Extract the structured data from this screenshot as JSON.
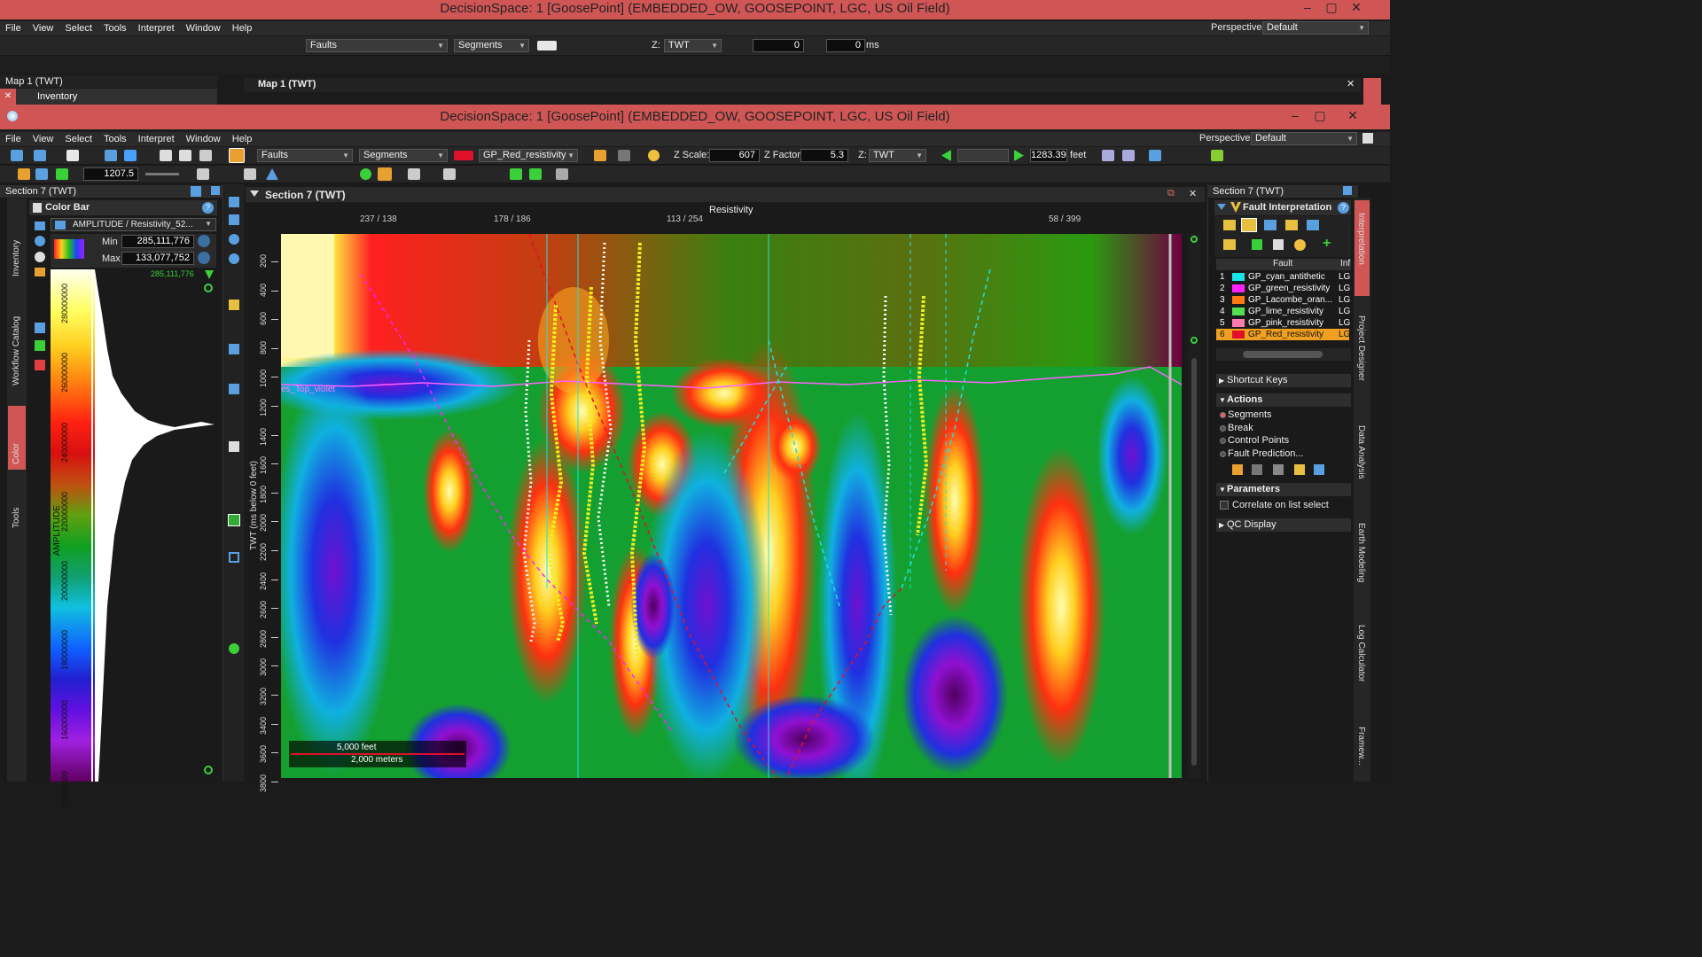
{
  "back_window": {
    "title": "DecisionSpace: 1 [GoosePoint] (EMBEDDED_OW, GOOSEPOINT, LGC, US Oil Field)",
    "menu": [
      "File",
      "View",
      "Select",
      "Tools",
      "Interpret",
      "Window",
      "Help"
    ],
    "perspective_label": "Perspective:",
    "perspective_value": "Default",
    "toolbar": {
      "faults_combo": "Faults",
      "segments_combo": "Segments",
      "z_combo": "TWT",
      "z_prefix": "Z:",
      "val1": "0",
      "val2": "0",
      "unit": "ms"
    },
    "map_panel_title": "Map 1 (TWT)",
    "inventory_tab": "Inventory",
    "map_view_title": "Map 1 (TWT)"
  },
  "window": {
    "title": "DecisionSpace: 1 [GoosePoint] (EMBEDDED_OW, GOOSEPOINT, LGC, US Oil Field)",
    "menu": [
      "File",
      "View",
      "Select",
      "Tools",
      "Interpret",
      "Window",
      "Help"
    ],
    "perspective_label": "Perspective:",
    "perspective_value": "Default"
  },
  "toolbar": {
    "faults_combo": "Faults",
    "segments_combo": "Segments",
    "property_combo": "GP_Red_resistivity",
    "zscale_label": "Z Scale:",
    "zscale_value": "607",
    "zfactor_label": "Z Factor:",
    "zfactor_value": "5.3",
    "z_label": "Z:",
    "z_combo": "TWT",
    "depth_value": "1283.39",
    "depth_unit": "feet",
    "secondary_value": "1207.5",
    "property_color": "#e0102a"
  },
  "left_panel": {
    "title": "Section 7 (TWT)",
    "colorbar_title": "Color Bar",
    "attribute": "AMPLITUDE / Resistivity_52...",
    "min_label": "Min",
    "min_value": "285,111,776",
    "max_label": "Max",
    "max_value": "133,077,752",
    "top_marker": "285,111,776",
    "axis_label": "AMPLITUDE",
    "ticks": [
      "280000000",
      "260000000",
      "240000000",
      "220000000",
      "200000000",
      "180000000",
      "160000000",
      "00000000"
    ],
    "vtabs": [
      "Inventory",
      "Workflow Catalog",
      "Color",
      "Tools"
    ]
  },
  "section": {
    "title": "Section 7 (TWT)",
    "header": "Resistivity",
    "top_ticks": [
      "237 / 138",
      "178 / 186",
      "113 / 254",
      "58 / 399"
    ],
    "y_label": "TWT (ms below 0 feet)",
    "y_ticks": [
      "200",
      "400",
      "600",
      "800",
      "1000",
      "1200",
      "1400",
      "1600",
      "1800",
      "2000",
      "2200",
      "2400",
      "2600",
      "2800",
      "3000",
      "3200",
      "3400",
      "3600",
      "3800"
    ],
    "horizon_label": "es_Top_violet",
    "scale_feet": "5,000 feet",
    "scale_meters": "2,000 meters"
  },
  "right_panel": {
    "title": "Section 7 (TWT)",
    "fault_title": "Fault Interpretation",
    "col_fault": "Fault",
    "col_info": "Inf",
    "faults": [
      {
        "n": "1",
        "name": "GP_cyan_antithetic",
        "color": "#18e6e6",
        "info": "LG"
      },
      {
        "n": "2",
        "name": "GP_green_resistivity",
        "color": "#ff22ff",
        "info": "LG"
      },
      {
        "n": "3",
        "name": "GP_Lacombe_oran...",
        "color": "#ff7a10",
        "info": "LG"
      },
      {
        "n": "4",
        "name": "GP_lime_resistivity",
        "color": "#52e052",
        "info": "LG"
      },
      {
        "n": "5",
        "name": "GP_pink_resistivity",
        "color": "#ff7ab0",
        "info": "LG"
      },
      {
        "n": "6",
        "name": "GP_Red_resistivity",
        "color": "#e0102a",
        "info": "LG"
      }
    ],
    "shortcut_keys": "Shortcut Keys",
    "actions": "Actions",
    "action_items": [
      "Segments",
      "Break",
      "Control Points",
      "Fault Prediction..."
    ],
    "parameters": "Parameters",
    "correlate": "Correlate on list select",
    "qc_display": "QC Display",
    "vtabs": [
      "Interpretation",
      "Project Designer",
      "Data Analysis",
      "Earth Modeling",
      "Log Calculator",
      "Framew..."
    ]
  }
}
